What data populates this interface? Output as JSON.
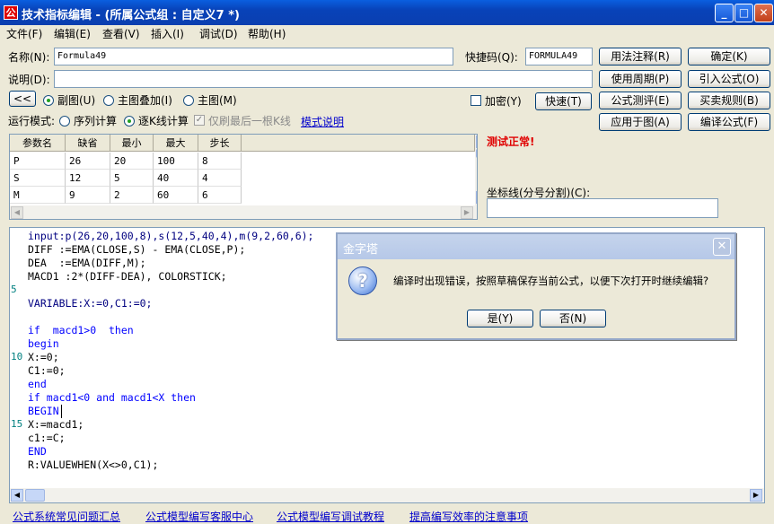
{
  "window": {
    "app_icon": "formula-app-icon",
    "app_icon_glyph": "公",
    "title": "技术指标编辑 - (所属公式组 : 自定义7 *)",
    "controls": {
      "minimize": "_",
      "maximize": "□",
      "close": "✕"
    }
  },
  "menu": [
    "文件(F)",
    "编辑(E)",
    "查看(V)",
    "插入(I)",
    "调试(D)",
    "帮助(H)"
  ],
  "form": {
    "name_label": "名称(N):",
    "name_value": "Formula49",
    "shortcut_label": "快捷码(Q):",
    "shortcut_value": "FORMULA49",
    "desc_label": "说明(D):",
    "desc_value": "",
    "collapse_button": "<<",
    "radio_sub": "副图(U)",
    "radio_overlay": "主图叠加(I)",
    "radio_main": "主图(M)",
    "selected_chart": "副图(U)",
    "encrypt_label": "加密(Y)",
    "encrypt_checked": false,
    "quick_button": "快速(T)",
    "run_mode_label": "运行模式:",
    "mode_sequence": "序列计算",
    "mode_bar": "逐K线计算",
    "selected_mode": "逐K线计算",
    "last_bar_label": "仅刷最后一根K线",
    "last_bar_checked": true,
    "mode_help_link": "模式说明"
  },
  "buttons": {
    "usage_notes": "用法注释(R)",
    "ok": "确定(K)",
    "usage_period": "使用周期(P)",
    "import_formula": "引入公式(O)",
    "test": "公式测评(E)",
    "trade_rules": "买卖规则(B)",
    "apply_chart": "应用于图(A)",
    "compile": "编译公式(F)"
  },
  "params": {
    "headers": [
      "参数名",
      "缺省",
      "最小",
      "最大",
      "步长"
    ],
    "rows": [
      [
        "P",
        "26",
        "20",
        "100",
        "8"
      ],
      [
        "S",
        "12",
        "5",
        "40",
        "4"
      ],
      [
        "M",
        "9",
        "2",
        "60",
        "6"
      ]
    ]
  },
  "status_text": "测试正常!",
  "status_color": "#e00000",
  "axis_label": "坐标线(分号分割)(C):",
  "axis_value": "",
  "code": {
    "line_numbers": [
      {
        "n": "5",
        "line": 5
      },
      {
        "n": "10",
        "line": 10
      },
      {
        "n": "15",
        "line": 15
      }
    ],
    "lines": [
      "input:p(26,20,100,8),s(12,5,40,4),m(9,2,60,6);",
      "DIFF :=EMA(CLOSE,S) - EMA(CLOSE,P);",
      "DEA  :=EMA(DIFF,M);",
      "MACD1 :2*(DIFF-DEA), COLORSTICK;",
      "",
      "VARIABLE:X:=0,C1:=0;",
      "",
      "if  macd1>0  then",
      "begin",
      "X:=0;",
      "C1:=0;",
      "end",
      "if macd1<0 and macd1<X then",
      "BEGIN",
      "X:=macd1;",
      "c1:=C;",
      "END",
      "R:VALUEWHEN(X<>0,C1);"
    ]
  },
  "footer_links": [
    "公式系统常见问题汇总",
    "公式模型编写客服中心",
    "公式模型编写调试教程",
    "提高编写效率的注意事项"
  ],
  "dialog": {
    "title": "金字塔",
    "icon": "question-icon",
    "icon_glyph": "?",
    "message": "编译时出现错误，按照草稿保存当前公式，以便下次打开时继续编辑?",
    "yes": "是(Y)",
    "no": "否(N)"
  }
}
